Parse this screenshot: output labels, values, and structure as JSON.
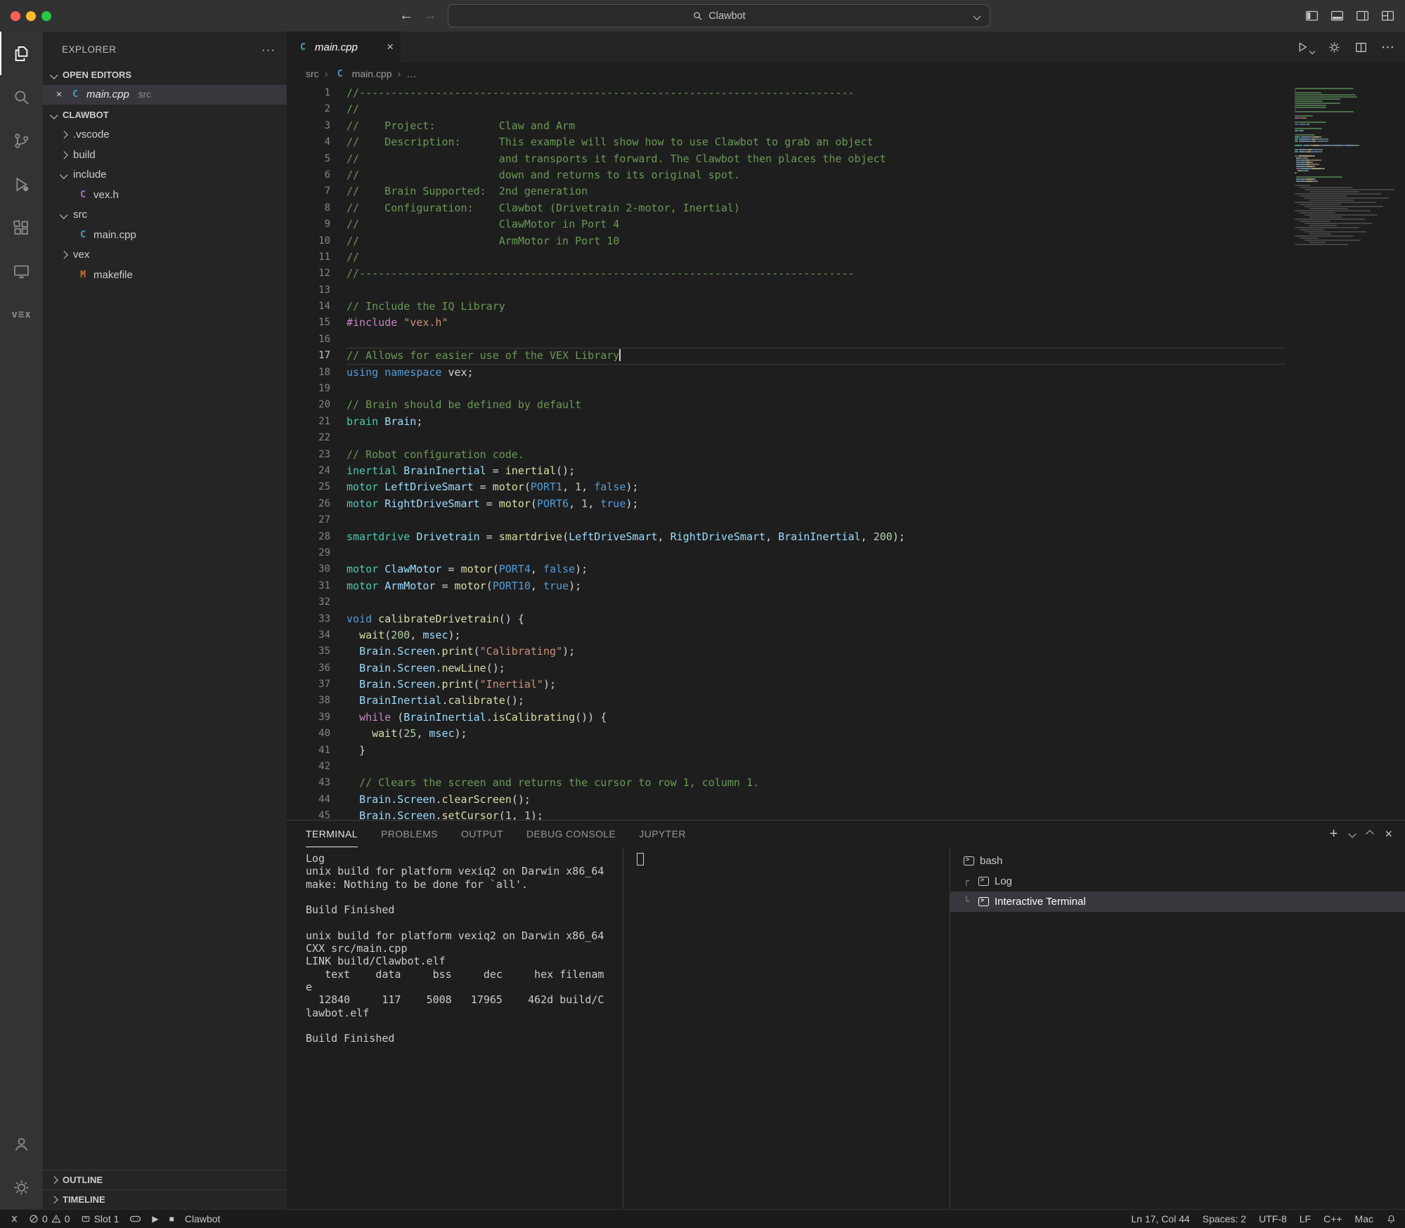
{
  "titlebar": {
    "back_icon": "←",
    "forward_icon": "→",
    "command_center": "Clawbot"
  },
  "activity_bar": {
    "items": [
      "explorer",
      "search",
      "source-control",
      "run-and-debug",
      "extensions",
      "remote-explorer",
      "vex"
    ],
    "vex_glyph": "v≡x",
    "bottom": [
      "account",
      "settings"
    ]
  },
  "sidebar": {
    "title": "EXPLORER",
    "actions_icon": "···",
    "open_editors": {
      "label": "OPEN EDITORS",
      "close_icon": "×",
      "items": [
        {
          "icon": "cpp",
          "label": "main.cpp",
          "detail": "src",
          "selected": true
        }
      ]
    },
    "folders": {
      "label": "CLAWBOT",
      "tree": [
        {
          "indent": 0,
          "chevron": "right",
          "label": ".vscode"
        },
        {
          "indent": 0,
          "chevron": "right",
          "label": "build"
        },
        {
          "indent": 0,
          "chevron": "down",
          "label": "include"
        },
        {
          "indent": 1,
          "icon": "h",
          "label": "vex.h"
        },
        {
          "indent": 0,
          "chevron": "down",
          "label": "src"
        },
        {
          "indent": 1,
          "icon": "cpp",
          "label": "main.cpp"
        },
        {
          "indent": 0,
          "chevron": "right",
          "label": "vex"
        },
        {
          "indent": 1,
          "icon": "m",
          "label": "makefile"
        }
      ]
    },
    "bottom_sections": [
      "OUTLINE",
      "TIMELINE"
    ]
  },
  "editor": {
    "tab": {
      "icon": "cpp",
      "label": "main.cpp",
      "close": "×"
    },
    "breadcrumb": [
      {
        "label": "src"
      },
      {
        "label": "main.cpp",
        "icon": "cpp"
      },
      {
        "label": "…"
      }
    ],
    "cursor_line": 17,
    "cursor_col": 44,
    "lines": [
      {
        "n": 1,
        "t": [
          [
            "c",
            "//------------------------------------------------------------------------------"
          ]
        ]
      },
      {
        "n": 2,
        "t": [
          [
            "c",
            "//"
          ]
        ]
      },
      {
        "n": 3,
        "t": [
          [
            "c",
            "//    Project:          Claw and Arm"
          ]
        ]
      },
      {
        "n": 4,
        "t": [
          [
            "c",
            "//    Description:      This example will show how to use Clawbot to grab an object"
          ]
        ]
      },
      {
        "n": 5,
        "t": [
          [
            "c",
            "//                      and transports it forward. The Clawbot then places the object"
          ]
        ]
      },
      {
        "n": 6,
        "t": [
          [
            "c",
            "//                      down and returns to its original spot."
          ]
        ]
      },
      {
        "n": 7,
        "t": [
          [
            "c",
            "//    Brain Supported:  2nd generation"
          ]
        ]
      },
      {
        "n": 8,
        "t": [
          [
            "c",
            "//    Configuration:    Clawbot (Drivetrain 2-motor, Inertial)"
          ]
        ]
      },
      {
        "n": 9,
        "t": [
          [
            "c",
            "//                      ClawMotor in Port 4"
          ]
        ]
      },
      {
        "n": 10,
        "t": [
          [
            "c",
            "//                      ArmMotor in Port 10"
          ]
        ]
      },
      {
        "n": 11,
        "t": [
          [
            "c",
            "//"
          ]
        ]
      },
      {
        "n": 12,
        "t": [
          [
            "c",
            "//------------------------------------------------------------------------------"
          ]
        ]
      },
      {
        "n": 13,
        "t": []
      },
      {
        "n": 14,
        "t": [
          [
            "c",
            "// Include the IQ Library"
          ]
        ]
      },
      {
        "n": 15,
        "t": [
          [
            "p",
            "#include "
          ],
          [
            "s",
            "\"vex.h\""
          ]
        ]
      },
      {
        "n": 16,
        "t": []
      },
      {
        "n": 17,
        "t": [
          [
            "c",
            "// Allows for easier use of the VEX Library"
          ]
        ]
      },
      {
        "n": 18,
        "t": [
          [
            "k",
            "using"
          ],
          [
            "d",
            " "
          ],
          [
            "k",
            "namespace"
          ],
          [
            "d",
            " "
          ],
          [
            "d",
            "vex"
          ],
          [
            "d",
            ";"
          ]
        ]
      },
      {
        "n": 19,
        "t": []
      },
      {
        "n": 20,
        "t": [
          [
            "c",
            "// Brain should be defined by default"
          ]
        ]
      },
      {
        "n": 21,
        "t": [
          [
            "t",
            "brain"
          ],
          [
            "d",
            " "
          ],
          [
            "v",
            "Brain"
          ],
          [
            "d",
            ";"
          ]
        ]
      },
      {
        "n": 22,
        "t": []
      },
      {
        "n": 23,
        "t": [
          [
            "c",
            "// Robot configuration code."
          ]
        ]
      },
      {
        "n": 24,
        "t": [
          [
            "t",
            "inertial"
          ],
          [
            "d",
            " "
          ],
          [
            "v",
            "BrainInertial"
          ],
          [
            "d",
            " = "
          ],
          [
            "f",
            "inertial"
          ],
          [
            "d",
            "();"
          ]
        ]
      },
      {
        "n": 25,
        "t": [
          [
            "t",
            "motor"
          ],
          [
            "d",
            " "
          ],
          [
            "v",
            "LeftDriveSmart"
          ],
          [
            "d",
            " = "
          ],
          [
            "f",
            "motor"
          ],
          [
            "d",
            "("
          ],
          [
            "k",
            "PORT1"
          ],
          [
            "d",
            ", "
          ],
          [
            "n",
            "1"
          ],
          [
            "d",
            ", "
          ],
          [
            "k",
            "false"
          ],
          [
            "d",
            ");"
          ]
        ]
      },
      {
        "n": 26,
        "t": [
          [
            "t",
            "motor"
          ],
          [
            "d",
            " "
          ],
          [
            "v",
            "RightDriveSmart"
          ],
          [
            "d",
            " = "
          ],
          [
            "f",
            "motor"
          ],
          [
            "d",
            "("
          ],
          [
            "k",
            "PORT6"
          ],
          [
            "d",
            ", "
          ],
          [
            "n",
            "1"
          ],
          [
            "d",
            ", "
          ],
          [
            "k",
            "true"
          ],
          [
            "d",
            ");"
          ]
        ]
      },
      {
        "n": 27,
        "t": []
      },
      {
        "n": 28,
        "t": [
          [
            "t",
            "smartdrive"
          ],
          [
            "d",
            " "
          ],
          [
            "v",
            "Drivetrain"
          ],
          [
            "d",
            " = "
          ],
          [
            "f",
            "smartdrive"
          ],
          [
            "d",
            "("
          ],
          [
            "v",
            "LeftDriveSmart"
          ],
          [
            "d",
            ", "
          ],
          [
            "v",
            "RightDriveSmart"
          ],
          [
            "d",
            ", "
          ],
          [
            "v",
            "BrainInertial"
          ],
          [
            "d",
            ", "
          ],
          [
            "n",
            "200"
          ],
          [
            "d",
            ");"
          ]
        ]
      },
      {
        "n": 29,
        "t": []
      },
      {
        "n": 30,
        "t": [
          [
            "t",
            "motor"
          ],
          [
            "d",
            " "
          ],
          [
            "v",
            "ClawMotor"
          ],
          [
            "d",
            " = "
          ],
          [
            "f",
            "motor"
          ],
          [
            "d",
            "("
          ],
          [
            "k",
            "PORT4"
          ],
          [
            "d",
            ", "
          ],
          [
            "k",
            "false"
          ],
          [
            "d",
            ");"
          ]
        ]
      },
      {
        "n": 31,
        "t": [
          [
            "t",
            "motor"
          ],
          [
            "d",
            " "
          ],
          [
            "v",
            "ArmMotor"
          ],
          [
            "d",
            " = "
          ],
          [
            "f",
            "motor"
          ],
          [
            "d",
            "("
          ],
          [
            "k",
            "PORT10"
          ],
          [
            "d",
            ", "
          ],
          [
            "k",
            "true"
          ],
          [
            "d",
            ");"
          ]
        ]
      },
      {
        "n": 32,
        "t": []
      },
      {
        "n": 33,
        "t": [
          [
            "k",
            "void"
          ],
          [
            "d",
            " "
          ],
          [
            "f",
            "calibrateDrivetrain"
          ],
          [
            "d",
            "() {"
          ]
        ]
      },
      {
        "n": 34,
        "t": [
          [
            "d",
            "  "
          ],
          [
            "f",
            "wait"
          ],
          [
            "d",
            "("
          ],
          [
            "n",
            "200"
          ],
          [
            "d",
            ", "
          ],
          [
            "v",
            "msec"
          ],
          [
            "d",
            ");"
          ]
        ]
      },
      {
        "n": 35,
        "t": [
          [
            "d",
            "  "
          ],
          [
            "v",
            "Brain"
          ],
          [
            "d",
            "."
          ],
          [
            "v",
            "Screen"
          ],
          [
            "d",
            "."
          ],
          [
            "f",
            "print"
          ],
          [
            "d",
            "("
          ],
          [
            "s",
            "\"Calibrating\""
          ],
          [
            "d",
            ");"
          ]
        ]
      },
      {
        "n": 36,
        "t": [
          [
            "d",
            "  "
          ],
          [
            "v",
            "Brain"
          ],
          [
            "d",
            "."
          ],
          [
            "v",
            "Screen"
          ],
          [
            "d",
            "."
          ],
          [
            "f",
            "newLine"
          ],
          [
            "d",
            "();"
          ]
        ]
      },
      {
        "n": 37,
        "t": [
          [
            "d",
            "  "
          ],
          [
            "v",
            "Brain"
          ],
          [
            "d",
            "."
          ],
          [
            "v",
            "Screen"
          ],
          [
            "d",
            "."
          ],
          [
            "f",
            "print"
          ],
          [
            "d",
            "("
          ],
          [
            "s",
            "\"Inertial\""
          ],
          [
            "d",
            ");"
          ]
        ]
      },
      {
        "n": 38,
        "t": [
          [
            "d",
            "  "
          ],
          [
            "v",
            "BrainInertial"
          ],
          [
            "d",
            "."
          ],
          [
            "f",
            "calibrate"
          ],
          [
            "d",
            "();"
          ]
        ]
      },
      {
        "n": 39,
        "t": [
          [
            "d",
            "  "
          ],
          [
            "p",
            "while"
          ],
          [
            "d",
            " ("
          ],
          [
            "v",
            "BrainInertial"
          ],
          [
            "d",
            "."
          ],
          [
            "f",
            "isCalibrating"
          ],
          [
            "d",
            "()) {"
          ]
        ]
      },
      {
        "n": 40,
        "t": [
          [
            "d",
            "    "
          ],
          [
            "f",
            "wait"
          ],
          [
            "d",
            "("
          ],
          [
            "n",
            "25"
          ],
          [
            "d",
            ", "
          ],
          [
            "v",
            "msec"
          ],
          [
            "d",
            ");"
          ]
        ]
      },
      {
        "n": 41,
        "t": [
          [
            "d",
            "  }"
          ]
        ]
      },
      {
        "n": 42,
        "t": []
      },
      {
        "n": 43,
        "t": [
          [
            "d",
            "  "
          ],
          [
            "c",
            "// Clears the screen and returns the cursor to row 1, column 1."
          ]
        ]
      },
      {
        "n": 44,
        "t": [
          [
            "d",
            "  "
          ],
          [
            "v",
            "Brain"
          ],
          [
            "d",
            "."
          ],
          [
            "v",
            "Screen"
          ],
          [
            "d",
            "."
          ],
          [
            "f",
            "clearScreen"
          ],
          [
            "d",
            "();"
          ]
        ]
      },
      {
        "n": 45,
        "t": [
          [
            "d",
            "  "
          ],
          [
            "v",
            "Brain"
          ],
          [
            "d",
            "."
          ],
          [
            "v",
            "Screen"
          ],
          [
            "d",
            "."
          ],
          [
            "f",
            "setCursor"
          ],
          [
            "d",
            "("
          ],
          [
            "n",
            "1"
          ],
          [
            "d",
            ", "
          ],
          [
            "n",
            "1"
          ],
          [
            "d",
            ");"
          ]
        ]
      }
    ]
  },
  "panel": {
    "tabs": [
      {
        "label": "TERMINAL",
        "active": true
      },
      {
        "label": "PROBLEMS"
      },
      {
        "label": "OUTPUT"
      },
      {
        "label": "DEBUG CONSOLE"
      },
      {
        "label": "JUPYTER"
      }
    ],
    "actions": {
      "new": "+",
      "close": "×"
    },
    "terminal_output": [
      "Log",
      "unix build for platform vexiq2 on Darwin x86_64",
      "make: Nothing to be done for `all'.",
      "",
      "Build Finished",
      "",
      "unix build for platform vexiq2 on Darwin x86_64",
      "CXX src/main.cpp",
      "LINK build/Clawbot.elf",
      "   text    data     bss     dec     hex filenam",
      "e",
      "  12840     117    5008   17965    462d build/C",
      "lawbot.elf",
      "",
      "Build Finished"
    ],
    "terminal_list": [
      {
        "label": "bash",
        "indent": 0
      },
      {
        "label": "Log",
        "indent": 1,
        "connector": "┌"
      },
      {
        "label": "Interactive Terminal",
        "indent": 1,
        "connector": "└",
        "selected": true
      }
    ]
  },
  "status_bar": {
    "left": {
      "errors": "0",
      "warnings": "0",
      "slot": "Slot 1",
      "run_icon": "▶",
      "stop_icon": "■",
      "project": "Clawbot"
    },
    "right": {
      "cursor_position": "Ln 17, Col 44",
      "indentation": "Spaces: 2",
      "encoding": "UTF-8",
      "eol": "LF",
      "language": "C++",
      "keymap": "Mac"
    }
  }
}
